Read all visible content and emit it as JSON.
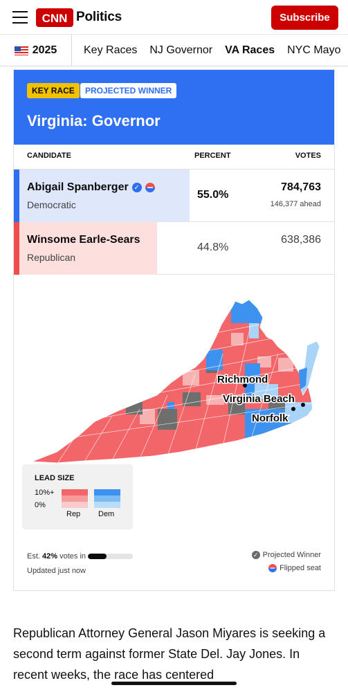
{
  "header": {
    "menu_icon": "hamburger-icon",
    "logo_text": "CNN",
    "section": "Politics",
    "subscribe_label": "Subscribe"
  },
  "nav": {
    "year": "2025",
    "flag_icon": "us-flag-icon",
    "items": [
      "Key Races",
      "NJ Governor",
      "VA Races",
      "NYC Mayo"
    ],
    "active": "VA Races"
  },
  "race": {
    "key_race_label": "KEY RACE",
    "projected_label": "PROJECTED WINNER",
    "title": "Virginia: Governor",
    "columns": {
      "candidate": "CANDIDATE",
      "percent": "PERCENT",
      "votes": "VOTES"
    },
    "candidates": [
      {
        "name": "Abigail Spanberger",
        "party": "Democratic",
        "percent": "55.0%",
        "votes": "784,763",
        "ahead": "146,377 ahead",
        "winner": true,
        "flipped": true,
        "color": "#2f6ff2",
        "bg": "#dfe8fb"
      },
      {
        "name": "Winsome Earle-Sears",
        "party": "Republican",
        "percent": "44.8%",
        "votes": "638,386",
        "ahead": "",
        "winner": false,
        "flipped": false,
        "color": "#ef4e4e",
        "bg": "#fde0de"
      }
    ]
  },
  "map": {
    "cities": [
      "Richmond",
      "Virginia Beach",
      "Norfolk"
    ],
    "colors": {
      "rep_strong": "#f2666a",
      "rep_light": "#f7b2b2",
      "dem_strong": "#3d92ef",
      "dem_light": "#a9d4f7",
      "no_result": "#6e6e6e"
    }
  },
  "legend": {
    "title": "LEAD SIZE",
    "high": "10%+",
    "low": "0%",
    "rep": "Rep",
    "dem": "Dem",
    "rep_strong": "#f2666a",
    "rep_mid": "#f79a9a",
    "rep_light": "#fbcaca",
    "dem_strong": "#3d92ef",
    "dem_mid": "#7cbcf4",
    "dem_light": "#b9ddf9"
  },
  "footer": {
    "est_prefix": "Est.",
    "est_percent": "42%",
    "est_suffix": "votes in",
    "votes_in_fraction": 0.42,
    "updated": "Updated just now",
    "projected_winner": "Projected Winner",
    "flipped_seat": "Flipped seat"
  },
  "article": {
    "text": "Republican Attorney General Jason Miyares is seeking a second term against former State Del. Jay Jones. In recent weeks, the race has centered"
  }
}
